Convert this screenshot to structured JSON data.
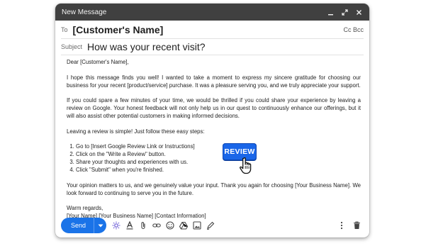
{
  "window": {
    "title": "New Message"
  },
  "to": {
    "label": "To",
    "value": "[Customer's Name]",
    "cc_bcc": "Cc Bcc"
  },
  "subject": {
    "label": "Subject",
    "value": "How was your recent visit?"
  },
  "body": {
    "greeting": "Dear [Customer's Name],",
    "para1": "I hope this message finds you well! I wanted to take a moment to express my sincere gratitude for choosing our business for your recent [product/service] purchase. It was a pleasure serving you, and we truly appreciate your support.",
    "para2": "If you could spare a few minutes of your time, we would be thrilled if you could share your experience by leaving a review on Google. Your honest feedback will not only help us in our quest to continuously enhance our offerings, but it will also assist other potential customers in making informed decisions.",
    "steps_intro": "Leaving a review is simple! Just follow these easy steps:",
    "steps": [
      "Go to [Insert Google Review Link or Instructions]",
      "Click on the \"Write a Review\" button.",
      "Share your thoughts and experiences with us.",
      "Click \"Submit\" when you're finished."
    ],
    "para3": "Your opinion matters to us, and we genuinely value your input. Thank you again for choosing [Your Business Name]. We look forward to continuing to serve you in the future.",
    "closing": "Warm regards,",
    "signature": "[Your Name] [Your Business Name] [Contact Information]"
  },
  "review_button": {
    "label": "REVIEW"
  },
  "footer": {
    "send_label": "Send"
  },
  "colors": {
    "titlebar": "#404040",
    "send": "#1a73e8",
    "review": "#1a66e8"
  }
}
